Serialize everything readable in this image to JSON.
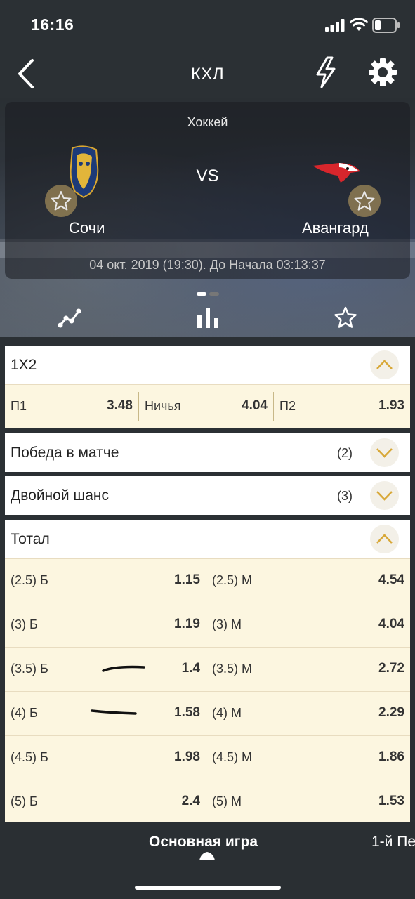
{
  "status": {
    "time": "16:16"
  },
  "nav": {
    "title": "КХЛ"
  },
  "event": {
    "sport": "Хоккей",
    "vs": "VS",
    "team1": "Сочи",
    "team2": "Авангард",
    "info": "04 окт. 2019 (19:30). До Начала   03:13:37"
  },
  "markets": {
    "m1x2": {
      "title": "1X2",
      "p1_label": "П1",
      "p1": "3.48",
      "draw_label": "Ничья",
      "draw": "4.04",
      "p2_label": "П2",
      "p2": "1.93"
    },
    "win": {
      "title": "Победа в матче",
      "count": "(2)"
    },
    "double": {
      "title": "Двойной шанс",
      "count": "(3)"
    },
    "total": {
      "title": "Тотал",
      "rows": [
        {
          "over_label": "(2.5) Б",
          "over": "1.15",
          "under_label": "(2.5) М",
          "under": "4.54"
        },
        {
          "over_label": "(3) Б",
          "over": "1.19",
          "under_label": "(3) М",
          "under": "4.04"
        },
        {
          "over_label": "(3.5) Б",
          "over": "1.4",
          "under_label": "(3.5) М",
          "under": "2.72"
        },
        {
          "over_label": "(4) Б",
          "over": "1.58",
          "under_label": "(4) М",
          "under": "2.29"
        },
        {
          "over_label": "(4.5) Б",
          "over": "1.98",
          "under_label": "(4.5) М",
          "under": "1.86"
        },
        {
          "over_label": "(5) Б",
          "over": "2.4",
          "under_label": "(5) М",
          "under": "1.53"
        }
      ]
    }
  },
  "tabs": {
    "main": "Основная игра",
    "next": "1-й Пе"
  },
  "icons": {
    "back": "chevron-left-icon",
    "bolt": "lightning-icon",
    "gear": "gear-icon",
    "stats": "chart-line-icon",
    "bars": "bar-chart-icon",
    "fav": "star-icon"
  },
  "colors": {
    "background": "#2b3034",
    "odds_bg": "#fcf6e0",
    "accent": "#d8a838",
    "white": "#ffffff"
  }
}
